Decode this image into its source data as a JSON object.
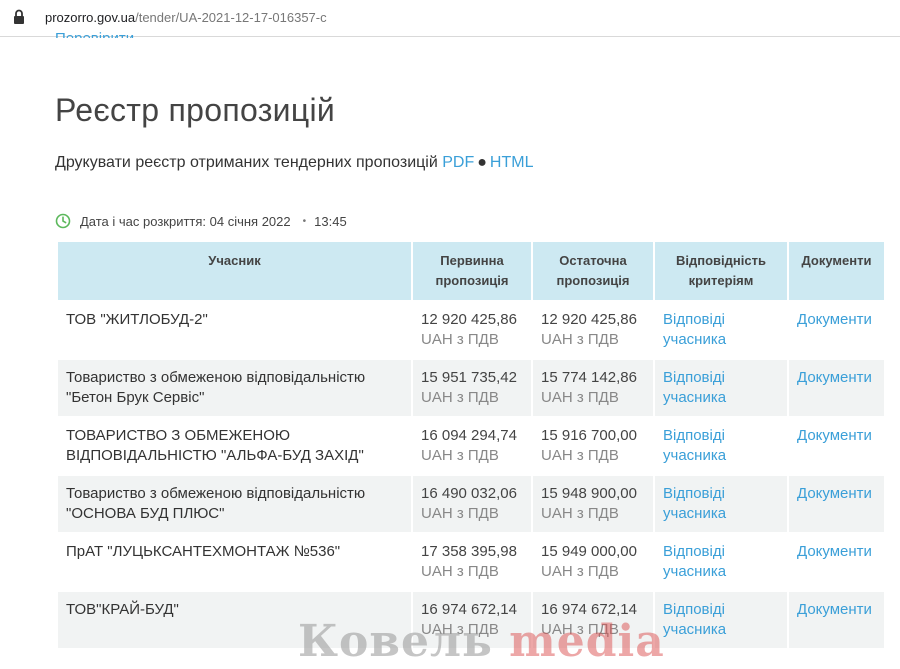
{
  "browser": {
    "url_host": "prozorro.gov.ua",
    "url_path": "/tender/UA-2021-12-17-016357-c"
  },
  "header": {
    "cut_link": "Перевірити",
    "title": "Реєстр пропозицій",
    "print_text": "Друкувати реєстр отриманих тендерних пропозицій",
    "pdf_label": "PDF",
    "dot": "●",
    "html_label": "HTML"
  },
  "open_date": {
    "label": "Дата і час розкриття: 04 січня 2022",
    "separator": "•",
    "time": "13:45"
  },
  "table": {
    "headers": [
      "Учасник",
      "Первинна пропозиція",
      "Остаточна пропозиція",
      "Відповідність критеріям",
      "Документи"
    ],
    "rows": [
      {
        "participant": "ТОВ \"ЖИТЛОБУД-2\"",
        "initial": "12 920 425,86",
        "final": "12 920 425,86",
        "vat": "UAH з ПДВ",
        "criteria": "Відповіді учасника",
        "docs": "Документи"
      },
      {
        "participant": "Товариство з обмеженою відповідальністю \"Бетон Брук Сервіс\"",
        "initial": "15 951 735,42",
        "final": "15 774 142,86",
        "vat": "UAH з ПДВ",
        "criteria": "Відповіді учасника",
        "docs": "Документи"
      },
      {
        "participant": "ТОВАРИСТВО З ОБМЕЖЕНОЮ ВІДПОВІДАЛЬНІСТЮ \"АЛЬФА-БУД ЗАХІД\"",
        "initial": "16 094 294,74",
        "final": "15 916 700,00",
        "vat": "UAH з ПДВ",
        "criteria": "Відповіді учасника",
        "docs": "Документи"
      },
      {
        "participant": "Товариство з обмеженою відповідальністю \"ОСНОВА БУД ПЛЮС\"",
        "initial": "16 490 032,06",
        "final": "15 948 900,00",
        "vat": "UAH з ПДВ",
        "criteria": "Відповіді учасника",
        "docs": "Документи"
      },
      {
        "participant": "ПрАТ \"ЛУЦЬКСАНТЕХМОНТАЖ №536\"",
        "initial": "17 358 395,98",
        "final": "15 949 000,00",
        "vat": "UAH з ПДВ",
        "criteria": "Відповіді учасника",
        "docs": "Документи"
      },
      {
        "participant": "ТОВ\"КРАЙ-БУД\"",
        "initial": "16 974 672,14",
        "final": "16 974 672,14",
        "vat": "UAH з ПДВ",
        "criteria": "Відповіді учасника",
        "docs": "Документи"
      }
    ]
  },
  "watermark": {
    "part1": "Ковель",
    "part2": "media"
  },
  "colors": {
    "link": "#3a9fd8",
    "header_bg": "#cde9f2",
    "row_alt_bg": "#f1f3f3",
    "clock": "#5cb85c"
  },
  "icons": {
    "lock": "lock-icon",
    "clock": "clock-icon"
  }
}
